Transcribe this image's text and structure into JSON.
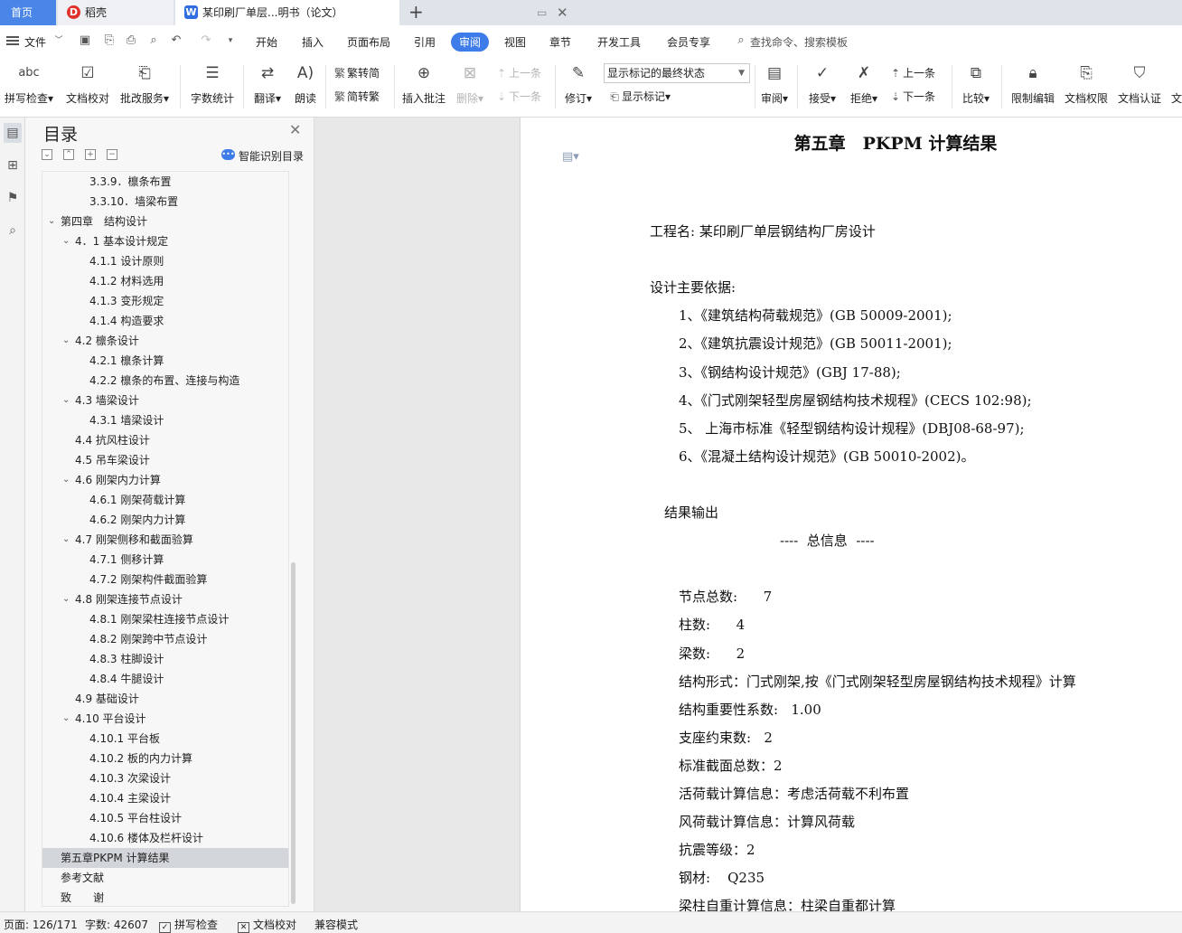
{
  "tabs": {
    "home": "首页",
    "daoke": "稻壳",
    "document": "某印刷厂单层...明书（论文）",
    "new_tab": "+"
  },
  "menu": {
    "file": "文件",
    "items": [
      "开始",
      "插入",
      "页面布局",
      "引用",
      "审阅",
      "视图",
      "章节",
      "开发工具",
      "会员专享"
    ],
    "active": "审阅",
    "search": "查找命令、搜索模板"
  },
  "ribbon": {
    "spell_check": "拼写检查",
    "doc_proof": "文档校对",
    "annotation_service": "批改服务",
    "word_count": "字数统计",
    "translate": "翻译",
    "read_aloud": "朗读",
    "trad_convert": "繁转简",
    "simp_convert": "简转繁",
    "insert_comment": "插入批注",
    "delete": "删除",
    "prev": "上一条",
    "next": "下一条",
    "track_changes": "修订",
    "markup_state": "显示标记的最终状态",
    "show_markup": "显示标记",
    "review_pane": "审阅",
    "accept": "接受",
    "reject": "拒绝",
    "prev_change": "上一条",
    "next_change": "下一条",
    "compare": "比较",
    "restrict_edit": "限制编辑",
    "doc_permission": "文档权限",
    "doc_certify": "文档认证",
    "more": "文"
  },
  "toc": {
    "title": "目录",
    "smart_detect": "智能识别目录",
    "items": [
      {
        "label": "3.3.9．檩条布置",
        "level": 3,
        "expanded": null,
        "selected": false
      },
      {
        "label": "3.3.10．墙梁布置",
        "level": 3,
        "expanded": null,
        "selected": false
      },
      {
        "label": "第四章　结构设计",
        "level": 1,
        "expanded": true,
        "selected": false
      },
      {
        "label": "4．1 基本设计规定",
        "level": 2,
        "expanded": true,
        "selected": false
      },
      {
        "label": "4.1.1 设计原则",
        "level": 3,
        "expanded": null,
        "selected": false
      },
      {
        "label": "4.1.2 材料选用",
        "level": 3,
        "expanded": null,
        "selected": false
      },
      {
        "label": "4.1.3 变形规定",
        "level": 3,
        "expanded": null,
        "selected": false
      },
      {
        "label": "4.1.4 构造要求",
        "level": 3,
        "expanded": null,
        "selected": false
      },
      {
        "label": "4.2 檩条设计",
        "level": 2,
        "expanded": true,
        "selected": false
      },
      {
        "label": "4.2.1 檩条计算",
        "level": 3,
        "expanded": null,
        "selected": false
      },
      {
        "label": "4.2.2 檩条的布置、连接与构造",
        "level": 3,
        "expanded": null,
        "selected": false
      },
      {
        "label": "4.3 墙梁设计",
        "level": 2,
        "expanded": true,
        "selected": false
      },
      {
        "label": "4.3.1 墙梁设计",
        "level": 3,
        "expanded": null,
        "selected": false
      },
      {
        "label": "4.4 抗风柱设计",
        "level": 2,
        "expanded": null,
        "selected": false
      },
      {
        "label": "4.5 吊车梁设计",
        "level": 2,
        "expanded": null,
        "selected": false
      },
      {
        "label": "4.6 刚架内力计算",
        "level": 2,
        "expanded": true,
        "selected": false
      },
      {
        "label": "4.6.1 刚架荷载计算",
        "level": 3,
        "expanded": null,
        "selected": false
      },
      {
        "label": "4.6.2 刚架内力计算",
        "level": 3,
        "expanded": null,
        "selected": false
      },
      {
        "label": "4.7 刚架侧移和截面验算",
        "level": 2,
        "expanded": true,
        "selected": false
      },
      {
        "label": "4.7.1 侧移计算",
        "level": 3,
        "expanded": null,
        "selected": false
      },
      {
        "label": "4.7.2 刚架构件截面验算",
        "level": 3,
        "expanded": null,
        "selected": false
      },
      {
        "label": "4.8 刚架连接节点设计",
        "level": 2,
        "expanded": true,
        "selected": false
      },
      {
        "label": "4.8.1 刚架梁柱连接节点设计",
        "level": 3,
        "expanded": null,
        "selected": false
      },
      {
        "label": "4.8.2 刚架跨中节点设计",
        "level": 3,
        "expanded": null,
        "selected": false
      },
      {
        "label": "4.8.3 柱脚设计",
        "level": 3,
        "expanded": null,
        "selected": false
      },
      {
        "label": "4.8.4 牛腿设计",
        "level": 3,
        "expanded": null,
        "selected": false
      },
      {
        "label": "4.9 基础设计",
        "level": 2,
        "expanded": null,
        "selected": false
      },
      {
        "label": "4.10 平台设计",
        "level": 2,
        "expanded": true,
        "selected": false
      },
      {
        "label": "4.10.1 平台板",
        "level": 3,
        "expanded": null,
        "selected": false
      },
      {
        "label": "4.10.2 板的内力计算",
        "level": 3,
        "expanded": null,
        "selected": false
      },
      {
        "label": "4.10.3 次梁设计",
        "level": 3,
        "expanded": null,
        "selected": false
      },
      {
        "label": "4.10.4 主梁设计",
        "level": 3,
        "expanded": null,
        "selected": false
      },
      {
        "label": "4.10.5 平台柱设计",
        "level": 3,
        "expanded": null,
        "selected": false
      },
      {
        "label": "4.10.6 楼体及栏杆设计",
        "level": 3,
        "expanded": null,
        "selected": false
      },
      {
        "label": "第五章PKPM 计算结果",
        "level": 1,
        "expanded": null,
        "selected": true
      },
      {
        "label": "参考文献",
        "level": 1,
        "expanded": null,
        "selected": false
      },
      {
        "label": "致　　谢",
        "level": 1,
        "expanded": null,
        "selected": false
      }
    ]
  },
  "document": {
    "chapter_title": "第五章　PKPM 计算结果",
    "lines": [
      {
        "text": "工程名: 某印刷厂单层钢结构厂房设计",
        "indent": 0
      },
      {
        "text": "",
        "indent": 0
      },
      {
        "text": "设计主要依据:",
        "indent": 0
      },
      {
        "text": "1、《建筑结构荷载规范》(GB 50009-2001);",
        "indent": 2
      },
      {
        "text": "2、《建筑抗震设计规范》(GB 50011-2001);",
        "indent": 2
      },
      {
        "text": "3、《钢结构设计规范》(GBJ 17-88);",
        "indent": 2
      },
      {
        "text": "4、《门式刚架轻型房屋钢结构技术规程》(CECS 102:98);",
        "indent": 2
      },
      {
        "text": "5、 上海市标准《轻型钢结构设计规程》(DBJ08-68-97);",
        "indent": 2
      },
      {
        "text": "6、《混凝土结构设计规范》(GB 50010-2002)。",
        "indent": 2
      },
      {
        "text": "",
        "indent": 0
      },
      {
        "text": "结果输出",
        "indent": 1
      },
      {
        "text": "----  总信息  ----",
        "indent": 9
      },
      {
        "text": "",
        "indent": 0
      },
      {
        "text": "节点总数:      7",
        "indent": 2
      },
      {
        "text": "柱数:      4",
        "indent": 2
      },
      {
        "text": "梁数:      2",
        "indent": 2
      },
      {
        "text": "结构形式：门式刚架,按《门式刚架轻型房屋钢结构技术规程》计算",
        "indent": 2
      },
      {
        "text": "结构重要性系数:   1.00",
        "indent": 2
      },
      {
        "text": "支座约束数:   2",
        "indent": 2
      },
      {
        "text": "标准截面总数：2",
        "indent": 2
      },
      {
        "text": "活荷载计算信息：考虑活荷载不利布置",
        "indent": 2
      },
      {
        "text": "风荷载计算信息：计算风荷载",
        "indent": 2
      },
      {
        "text": "抗震等级：2",
        "indent": 2
      },
      {
        "text": "钢材:    Q235",
        "indent": 2
      },
      {
        "text": "梁柱自重计算信息：柱梁自重都计算",
        "indent": 2
      }
    ]
  },
  "status": {
    "page": "页面: 126/171",
    "words": "字数: 42607",
    "spell": "拼写检查",
    "proof": "文档校对",
    "compat": "兼容模式"
  }
}
